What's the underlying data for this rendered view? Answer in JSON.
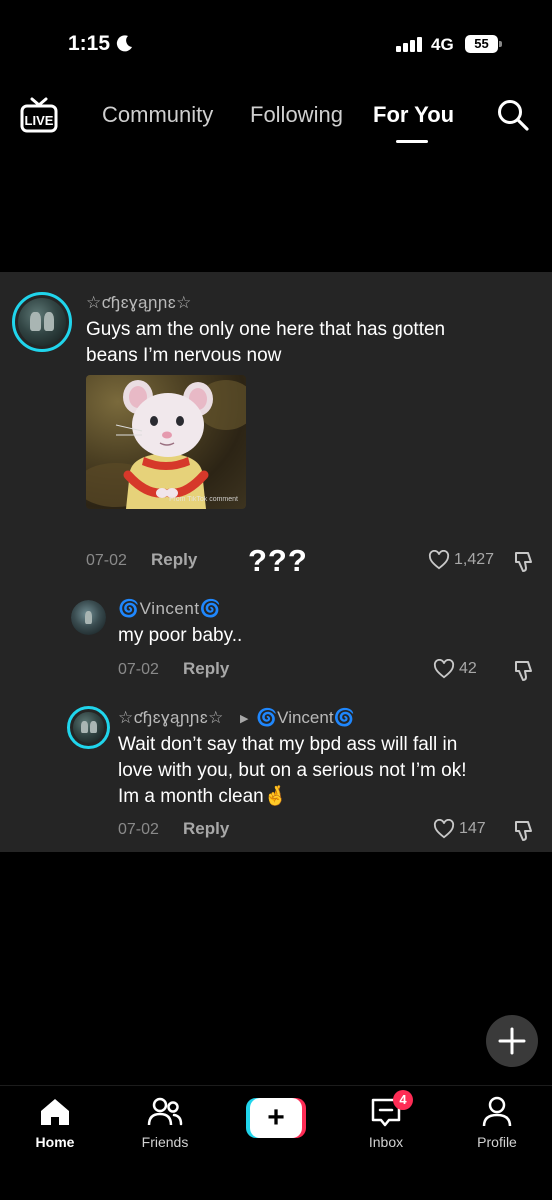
{
  "status_bar": {
    "time": "1:15",
    "network": "4G",
    "battery": "55"
  },
  "top_nav": {
    "live_label": "LIVE",
    "tabs": [
      "Community",
      "Following",
      "For You"
    ],
    "active_tab": "For You"
  },
  "comments": {
    "main": {
      "username": "☆ƈɧɛɣąɲɲɛ☆",
      "text_line1": "Guys am the only one here that has gotten",
      "text_line2": "beans I’m nervous now",
      "sticker_watermark": "From TikTok comment",
      "date": "07-02",
      "reply_label": "Reply",
      "likes": "1,427",
      "annotation": "???"
    },
    "replies": [
      {
        "username": "🌀Vincent🌀",
        "text": "my poor baby..",
        "date": "07-02",
        "reply_label": "Reply",
        "likes": "42"
      },
      {
        "username": "☆ƈɧɛɣąɲɲɛ☆",
        "reply_to": "🌀Vincent🌀",
        "text_line1": "Wait don’t say that my bpd ass will fall in",
        "text_line2": "love with you, but on a serious not I’m ok!",
        "text_line3": "Im a month clean🤞",
        "date": "07-02",
        "reply_label": "Reply",
        "likes": "147"
      }
    ]
  },
  "bottom_nav": {
    "items": [
      "Home",
      "Friends",
      "Inbox",
      "Profile"
    ],
    "inbox_badge": "4"
  },
  "colors": {
    "accent_cyan": "#20d5ec",
    "accent_pink": "#fe2c55",
    "panel_bg": "#252525"
  }
}
